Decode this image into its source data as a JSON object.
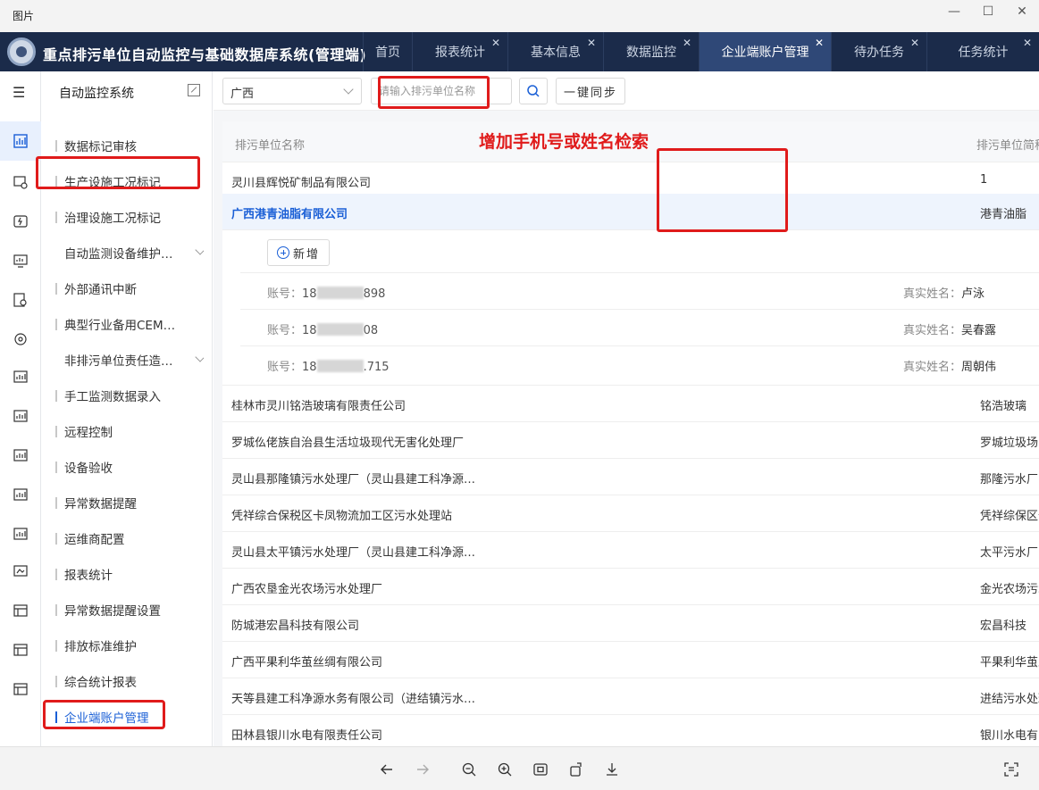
{
  "window": {
    "title": "图片",
    "minimize": "—",
    "maximize": "☐",
    "close": "✕"
  },
  "app": {
    "title": "重点排污单位自动监控与基础数据库系统(管理端)",
    "tabs": [
      {
        "label": "首页",
        "closable": false
      },
      {
        "label": "报表统计",
        "closable": true
      },
      {
        "label": "基本信息",
        "closable": true
      },
      {
        "label": "数据监控",
        "closable": true
      },
      {
        "label": "企业端账户管理",
        "closable": true,
        "active": true
      },
      {
        "label": "待办任务",
        "closable": true
      },
      {
        "label": "任务统计",
        "closable": true
      }
    ],
    "tab_close": "✕"
  },
  "sidebar": {
    "header": "自动监控系统",
    "items": [
      {
        "label": "数据标记审核"
      },
      {
        "label": "生产设施工况标记"
      },
      {
        "label": "治理设施工况标记"
      },
      {
        "label": "自动监测设备维护…",
        "expandable": true
      },
      {
        "label": "外部通讯中断"
      },
      {
        "label": "典型行业备用CEM…"
      },
      {
        "label": "非排污单位责任造…",
        "expandable": true
      },
      {
        "label": "手工监测数据录入"
      },
      {
        "label": "远程控制"
      },
      {
        "label": "设备验收"
      },
      {
        "label": "异常数据提醒"
      },
      {
        "label": "运维商配置"
      },
      {
        "label": "报表统计"
      },
      {
        "label": "异常数据提醒设置"
      },
      {
        "label": "排放标准维护"
      },
      {
        "label": "综合统计报表"
      },
      {
        "label": "企业端账户管理",
        "active": true
      }
    ]
  },
  "toolbar": {
    "region": "广西",
    "search_placeholder": "请输入排污单位名称",
    "sync_label": "一键同步"
  },
  "annotation": "增加手机号或姓名检索",
  "table": {
    "col_name": "排污单位名称",
    "col_short": "排污单位简称",
    "rows_before": [
      {
        "name": "灵川县辉悦矿制品有限公司",
        "short": "1"
      },
      {
        "name": "广西港青油脂有限公司",
        "short": "港青油脂",
        "expanded": true
      }
    ],
    "expanded": {
      "add_label": "新增",
      "accounts": [
        {
          "account_label": "账号：",
          "acc_prefix": "18",
          "acc_suffix": "898",
          "name_label": "真实姓名：",
          "name": "卢泳"
        },
        {
          "account_label": "账号：",
          "acc_prefix": "18",
          "acc_suffix": "08",
          "name_label": "真实姓名：",
          "name": "吴春露"
        },
        {
          "account_label": "账号：",
          "acc_prefix": "18",
          "acc_suffix": ".715",
          "name_label": "真实姓名：",
          "name": "周朝伟"
        }
      ]
    },
    "rows_after": [
      {
        "name": "桂林市灵川铭浩玻璃有限责任公司",
        "short": "铭浩玻璃"
      },
      {
        "name": "罗城仫佬族自治县生活垃圾现代无害化处理厂",
        "short": "罗城垃圾场"
      },
      {
        "name": "灵山县那隆镇污水处理厂（灵山县建工科净源…",
        "short": "那隆污水厂"
      },
      {
        "name": "凭祥综合保税区卡凤物流加工区污水处理站",
        "short": "凭祥综保区卡"
      },
      {
        "name": "灵山县太平镇污水处理厂（灵山县建工科净源…",
        "short": "太平污水厂"
      },
      {
        "name": "广西农垦金光农场污水处理厂",
        "short": "金光农场污水"
      },
      {
        "name": "防城港宏昌科技有限公司",
        "short": "宏昌科技"
      },
      {
        "name": "广西平果利华茧丝绸有限公司",
        "short": "平果利华茧丝"
      },
      {
        "name": "天等县建工科净源水务有限公司（进结镇污水…",
        "short": "进结污水处理"
      },
      {
        "name": "田林县银川水电有限责任公司",
        "short": "银川水电有限"
      }
    ]
  },
  "viewer": {
    "icons": [
      "arrow-left-icon",
      "arrow-right-icon",
      "zoom-out-icon",
      "zoom-in-icon",
      "fit-icon",
      "rotate-icon",
      "download-icon",
      "ocr-icon"
    ]
  },
  "colors": {
    "header_bg": "#1b2b4a",
    "active_tab": "#2f4877",
    "accent": "#1a5fd6",
    "highlight": "#e01b1b"
  }
}
